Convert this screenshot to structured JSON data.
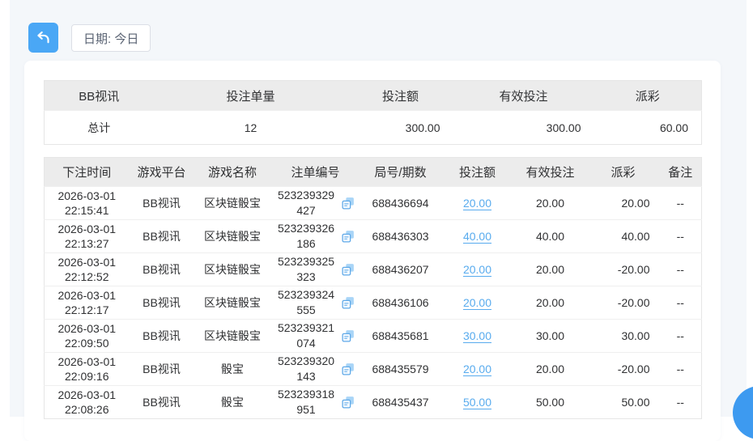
{
  "toolbar": {
    "date_filter_label": "日期: 今日"
  },
  "summary": {
    "columns": [
      "BB视讯",
      "投注单量",
      "投注额",
      "有效投注",
      "派彩"
    ],
    "total": {
      "label": "总计",
      "bet_count": "12",
      "bet_amount": "300.00",
      "valid_bet": "300.00",
      "payout": "60.00"
    }
  },
  "detail": {
    "columns": [
      "下注时间",
      "游戏平台",
      "游戏名称",
      "注单编号",
      "局号/期数",
      "投注额",
      "有效投注",
      "派彩",
      "备注"
    ],
    "rows": [
      {
        "bet_time": "2026-03-01 22:15:41",
        "platform": "BB视讯",
        "game_name": "区块链骰宝",
        "order_no": "523239329427",
        "round_no": "688436694",
        "bet_amount": "20.00",
        "valid_bet": "20.00",
        "payout": "20.00",
        "remark": "--"
      },
      {
        "bet_time": "2026-03-01 22:13:27",
        "platform": "BB视讯",
        "game_name": "区块链骰宝",
        "order_no": "523239326186",
        "round_no": "688436303",
        "bet_amount": "40.00",
        "valid_bet": "40.00",
        "payout": "40.00",
        "remark": "--"
      },
      {
        "bet_time": "2026-03-01 22:12:52",
        "platform": "BB视讯",
        "game_name": "区块链骰宝",
        "order_no": "523239325323",
        "round_no": "688436207",
        "bet_amount": "20.00",
        "valid_bet": "20.00",
        "payout": "-20.00",
        "remark": "--"
      },
      {
        "bet_time": "2026-03-01 22:12:17",
        "platform": "BB视讯",
        "game_name": "区块链骰宝",
        "order_no": "523239324555",
        "round_no": "688436106",
        "bet_amount": "20.00",
        "valid_bet": "20.00",
        "payout": "-20.00",
        "remark": "--"
      },
      {
        "bet_time": "2026-03-01 22:09:50",
        "platform": "BB视讯",
        "game_name": "区块链骰宝",
        "order_no": "523239321074",
        "round_no": "688435681",
        "bet_amount": "30.00",
        "valid_bet": "30.00",
        "payout": "30.00",
        "remark": "--"
      },
      {
        "bet_time": "2026-03-01 22:09:16",
        "platform": "BB视讯",
        "game_name": "骰宝",
        "order_no": "523239320143",
        "round_no": "688435579",
        "bet_amount": "20.00",
        "valid_bet": "20.00",
        "payout": "-20.00",
        "remark": "--"
      },
      {
        "bet_time": "2026-03-01 22:08:26",
        "platform": "BB视讯",
        "game_name": "骰宝",
        "order_no": "523239318951",
        "round_no": "688435437",
        "bet_amount": "50.00",
        "valid_bet": "50.00",
        "payout": "50.00",
        "remark": "--"
      }
    ]
  },
  "colors": {
    "accent_blue": "#4aa7f5",
    "link_blue": "#58abee",
    "negative_red": "#f1567c",
    "header_bg": "#ececec",
    "page_bg": "#f4f7fa"
  }
}
